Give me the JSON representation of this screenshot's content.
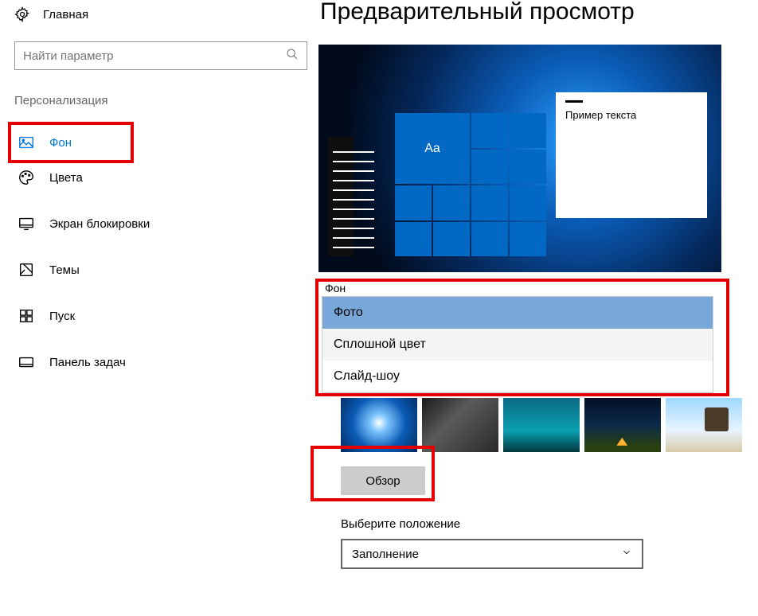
{
  "sidebar": {
    "home_label": "Главная",
    "search_placeholder": "Найти параметр",
    "section_title": "Персонализация",
    "items": [
      {
        "label": "Фон"
      },
      {
        "label": "Цвета"
      },
      {
        "label": "Экран блокировки"
      },
      {
        "label": "Темы"
      },
      {
        "label": "Пуск"
      },
      {
        "label": "Панель задач"
      }
    ]
  },
  "main": {
    "preview_title": "Предварительный просмотр",
    "sample_text": "Пример текста",
    "tile_text": "Aa",
    "background_label": "Фон",
    "background_options": [
      "Фото",
      "Сплошной цвет",
      "Слайд-шоу"
    ],
    "browse_label": "Обзор",
    "position_label": "Выберите положение",
    "position_value": "Заполнение"
  }
}
